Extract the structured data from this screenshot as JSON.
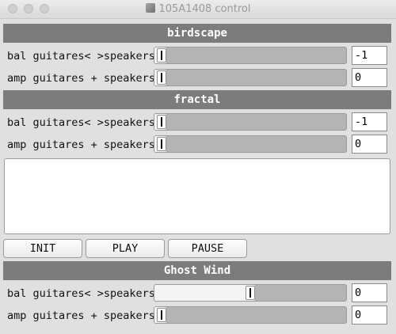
{
  "window": {
    "title": "105A1408 control"
  },
  "sections": [
    {
      "title": "birdscape",
      "rows": [
        {
          "label": "bal guitares< >speakers",
          "value": "-1",
          "level": 0.0
        },
        {
          "label": "amp guitares + speakers",
          "value": "0",
          "level": 0.0
        }
      ]
    },
    {
      "title": "fractal",
      "rows": [
        {
          "label": "bal guitares< >speakers",
          "value": "-1",
          "level": 0.0
        },
        {
          "label": "amp guitares + speakers",
          "value": "0",
          "level": 0.0
        }
      ]
    },
    {
      "title": "Ghost Wind",
      "rows": [
        {
          "label": "bal guitares< >speakers",
          "value": "0",
          "level": 0.5
        },
        {
          "label": "amp guitares + speakers",
          "value": "0",
          "level": 0.0
        }
      ]
    }
  ],
  "buttons": {
    "init": "INIT",
    "play": "PLAY",
    "pause": "PAUSE"
  },
  "colors": {
    "section_header_bg": "#7c7c7c",
    "slider_track": "#b4b4b4"
  }
}
